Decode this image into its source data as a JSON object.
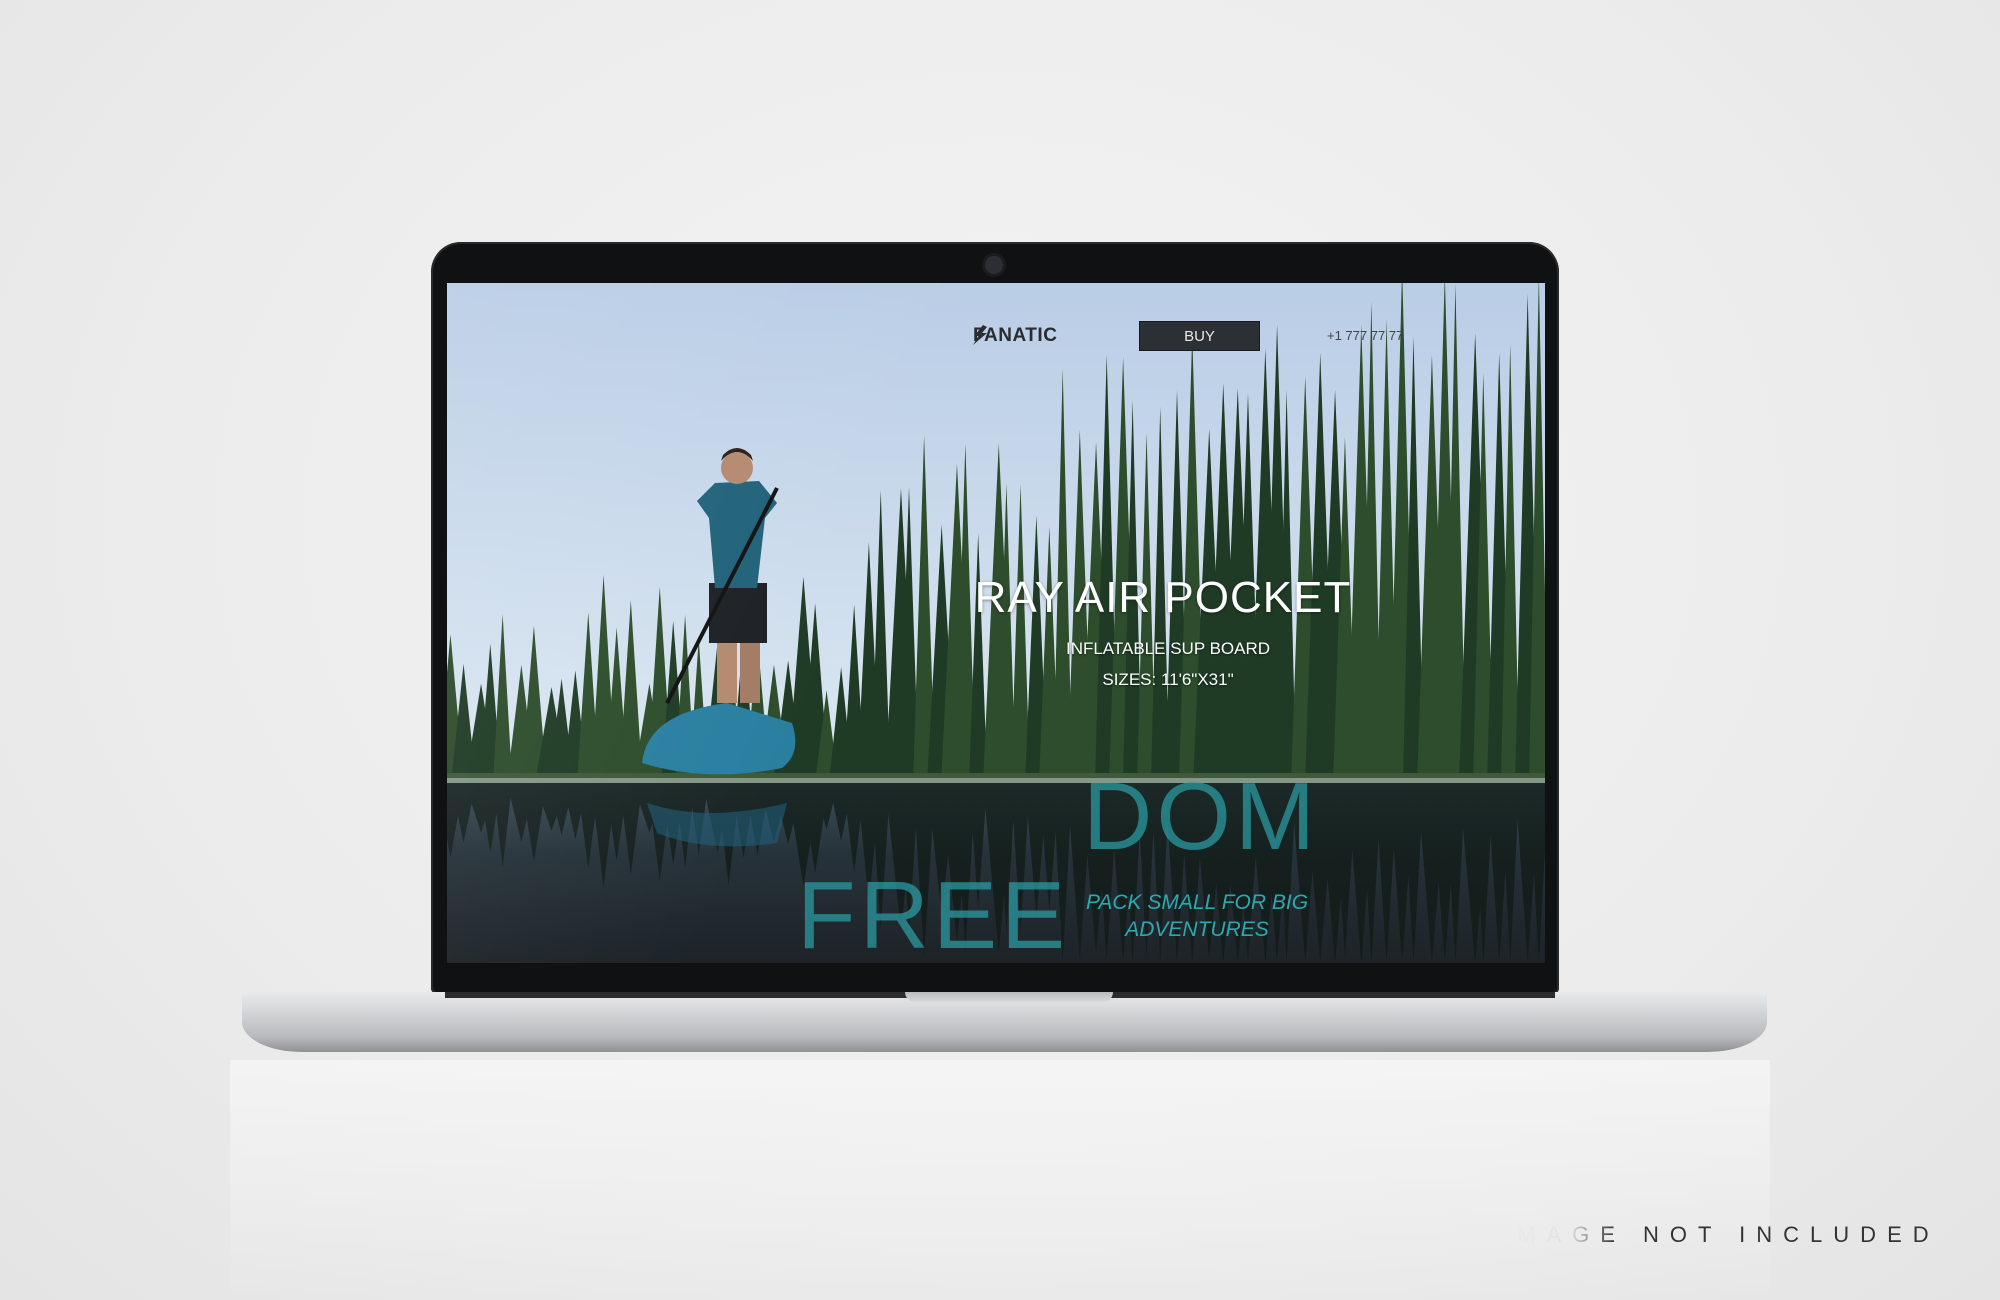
{
  "site": {
    "brand": "FANATIC",
    "buy_label": "BUY",
    "phone": "+1 777 77 77",
    "hero": {
      "title": "RAY AIR POCKET",
      "subtitle": "INFLATABLE SUP BOARD",
      "sizes": "SIZES: 11'6\"X31\"",
      "word_top": "DOM",
      "word_bottom": "FREE",
      "tagline_line1": "PACK SMALL FOR BIG",
      "tagline_line2": "ADVENTURES"
    },
    "colors": {
      "accent": "#2a9aa0",
      "button": "#2c3034"
    }
  },
  "watermark": "IMAGE NOT INCLUDED",
  "icons": {
    "logo": "fanatic-logo-icon",
    "camera": "webcam-icon"
  }
}
